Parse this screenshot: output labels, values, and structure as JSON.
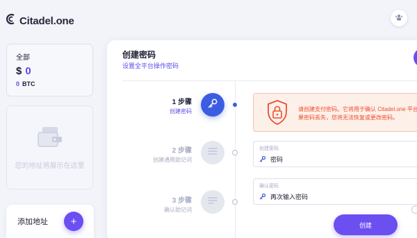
{
  "brand": {
    "name": "Citadel.one"
  },
  "balance": {
    "label": "全部",
    "currency_symbol": "$",
    "value": "0",
    "btc_value": "0",
    "btc_unit": "BTC"
  },
  "empty_wallet": {
    "text": "您的地址将展示在这里"
  },
  "add_address": {
    "label": "添加地址",
    "button_icon": "plus-icon",
    "button_symbol": "+"
  },
  "panel": {
    "title": "创建密码",
    "subtitle": "设置全平台操作密码",
    "steps": [
      {
        "title": "1 步骤",
        "subtitle": "创建密码",
        "icon": "key-icon",
        "active": true
      },
      {
        "title": "2 步骤",
        "subtitle": "创建通用助记词",
        "icon": "list-icon",
        "active": false
      },
      {
        "title": "3 步骤",
        "subtitle": "确认助记词",
        "icon": "list-check-icon",
        "active": false
      }
    ],
    "warning": {
      "line1": "请创建支付密码。它将用于确认 Citadel.one 平台",
      "line2": "果密码丢失，您将无法恢复或更改密码。"
    },
    "password_field": {
      "label": "创建密码",
      "placeholder": "密码"
    },
    "confirm_field": {
      "label": "确认密码",
      "placeholder": "再次输入密码"
    },
    "create_button": "创建"
  },
  "colors": {
    "accent": "#6b4ff0",
    "step_active": "#3c5de2",
    "warning": "#ee4d2d",
    "warning_bg": "#fdf0e9"
  }
}
